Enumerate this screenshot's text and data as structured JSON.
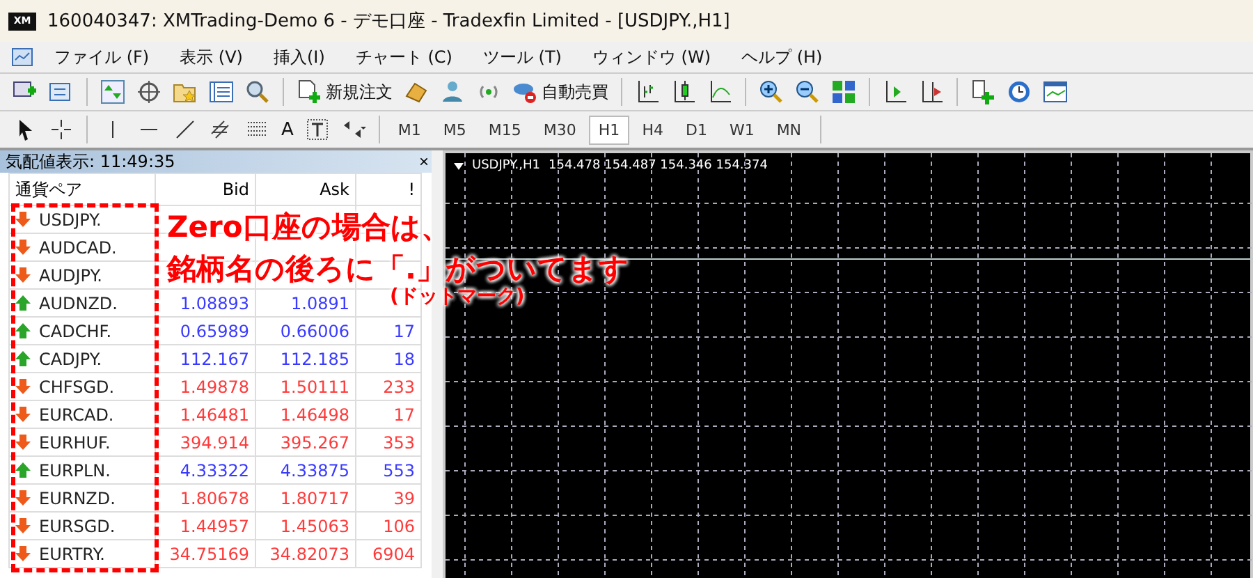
{
  "window": {
    "logo": "XM",
    "title": "160040347: XMTrading-Demo 6 - デモ口座 - Tradexfin Limited - [USDJPY.,H1]"
  },
  "menu": [
    "ファイル (F)",
    "表示 (V)",
    "挿入(I)",
    "チャート (C)",
    "ツール (T)",
    "ウィンドウ (W)",
    "ヘルプ (H)"
  ],
  "toolbar": {
    "new_order": "新規注文",
    "auto_trading": "自動売買"
  },
  "drawing_tools": [
    "A"
  ],
  "timeframes": [
    {
      "label": "M1",
      "selected": false
    },
    {
      "label": "M5",
      "selected": false
    },
    {
      "label": "M15",
      "selected": false
    },
    {
      "label": "M30",
      "selected": false
    },
    {
      "label": "H1",
      "selected": true
    },
    {
      "label": "H4",
      "selected": false
    },
    {
      "label": "D1",
      "selected": false
    },
    {
      "label": "W1",
      "selected": false
    },
    {
      "label": "MN",
      "selected": false
    }
  ],
  "market_watch": {
    "title": "気配値表示: 11:49:35",
    "close": "×",
    "columns": [
      "通貨ペア",
      "Bid",
      "Ask",
      "!"
    ],
    "rows": [
      {
        "symbol": "USDJPY.",
        "kind": "down"
      },
      {
        "symbol": "AUDCAD.",
        "kind": "down"
      },
      {
        "symbol": "AUDJPY.",
        "kind": "down"
      },
      {
        "symbol": "AUDNZD.",
        "kind": "up",
        "bid": "1.08893",
        "ask": "1.0891"
      },
      {
        "symbol": "CADCHF.",
        "kind": "up",
        "bid": "0.65989",
        "ask": "0.66006",
        "spread": "17"
      },
      {
        "symbol": "CADJPY.",
        "kind": "up",
        "bid": "112.167",
        "ask": "112.185",
        "spread": "18"
      },
      {
        "symbol": "CHFSGD.",
        "kind": "down",
        "bid": "1.49878",
        "ask": "1.50111",
        "spread": "233"
      },
      {
        "symbol": "EURCAD.",
        "kind": "down",
        "bid": "1.46481",
        "ask": "1.46498",
        "spread": "17"
      },
      {
        "symbol": "EURHUF.",
        "kind": "down",
        "bid": "394.914",
        "ask": "395.267",
        "spread": "353"
      },
      {
        "symbol": "EURPLN.",
        "kind": "up",
        "bid": "4.33322",
        "ask": "4.33875",
        "spread": "553"
      },
      {
        "symbol": "EURNZD.",
        "kind": "down",
        "bid": "1.80678",
        "ask": "1.80717",
        "spread": "39"
      },
      {
        "symbol": "EURSGD.",
        "kind": "down",
        "bid": "1.44957",
        "ask": "1.45063",
        "spread": "106"
      },
      {
        "symbol": "EURTRY.",
        "kind": "down",
        "bid": "34.75169",
        "ask": "34.82073",
        "spread": "6904"
      }
    ]
  },
  "chart": {
    "symbol": "USDJPY.,H1",
    "prices": "154.478 154.487 154.346 154.374"
  },
  "annotation": {
    "lines": [
      "Zero口座の場合は、",
      "銘柄名の後ろに「.」がついてます"
    ],
    "note": "(ドットマーク)"
  }
}
